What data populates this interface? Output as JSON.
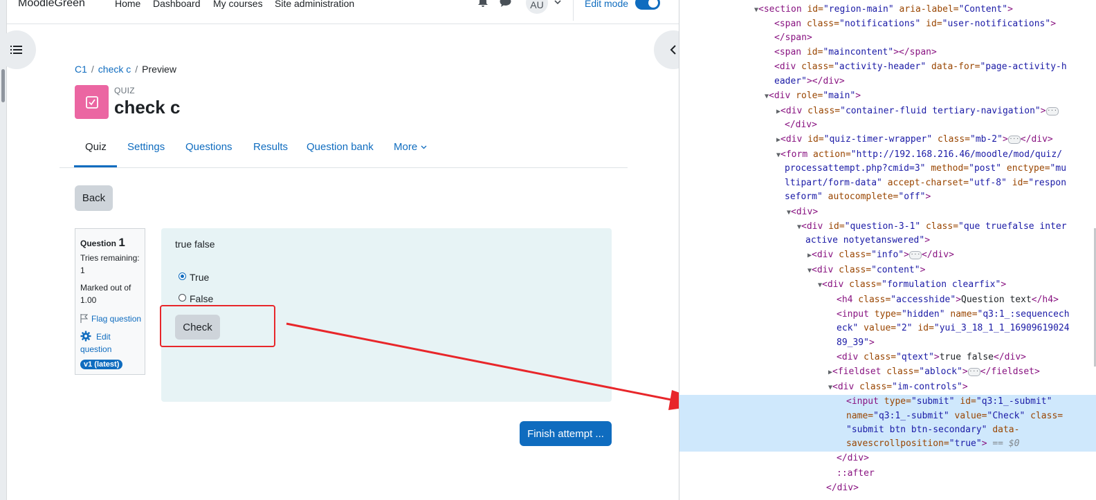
{
  "topnav": {
    "brand": "MoodleGreen",
    "links": [
      "Home",
      "Dashboard",
      "My courses",
      "Site administration"
    ],
    "avatar": "AU",
    "edit_mode": "Edit mode"
  },
  "breadcrumb": {
    "items": [
      "C1",
      "check c",
      "Preview"
    ]
  },
  "activity": {
    "type_label": "QUIZ",
    "title": "check c"
  },
  "tabs": [
    "Quiz",
    "Settings",
    "Questions",
    "Results",
    "Question bank",
    "More"
  ],
  "active_tab": "Quiz",
  "back_label": "Back",
  "question_info": {
    "question_word": "Question",
    "number": "1",
    "tries_label": "Tries remaining:",
    "tries_value": "1",
    "marked_label": "Marked out of",
    "marked_value": "1.00",
    "flag": "Flag question",
    "edit_line1": "Edit",
    "edit_line2": "question",
    "version": "v1 (latest)"
  },
  "question": {
    "text": "true false",
    "options": [
      "True",
      "False"
    ],
    "selected": "True",
    "check_label": "Check"
  },
  "finish_label": "Finish attempt ...",
  "devtools": {
    "l1": [
      "<section",
      " id=",
      "\"region-main\"",
      " aria-label=",
      "\"Content\"",
      ">"
    ],
    "l2": [
      "<span",
      " class=",
      "\"notifications\"",
      " id=",
      "\"user-notifications\"",
      ">"
    ],
    "l3": "</span>",
    "l4": [
      "<span",
      " id=",
      "\"maincontent\"",
      "></span>"
    ],
    "l5": [
      "<div",
      " class=",
      "\"activity-header\"",
      " data-for=",
      "\"page-activity-h"
    ],
    "l6": [
      "eader\"",
      "></div>"
    ],
    "l7": [
      "<div",
      " role=",
      "\"main\"",
      ">"
    ],
    "l8": [
      "<div",
      " class=",
      "\"container-fluid tertiary-navigation\"",
      ">"
    ],
    "l9": "</div>",
    "l10": [
      "<div",
      " id=",
      "\"quiz-timer-wrapper\"",
      " class=",
      "\"mb-2\"",
      ">",
      "</div>"
    ],
    "l11": [
      "<form",
      " action=",
      "\"http://192.168.216.46/moodle/mod/quiz/"
    ],
    "l12": [
      "processattempt.php?cmid=3\"",
      " method=",
      "\"post\"",
      " enctype=",
      "\"mu"
    ],
    "l13": [
      "ltipart/form-data\"",
      " accept-charset=",
      "\"utf-8\"",
      " id=",
      "\"respon"
    ],
    "l14": [
      "seform\"",
      " autocomplete=",
      "\"off\"",
      ">"
    ],
    "l15": "<div>",
    "l16": [
      "<div",
      " id=",
      "\"question-3-1\"",
      " class=",
      "\"que truefalse inter"
    ],
    "l17": [
      "active notyetanswered\"",
      ">"
    ],
    "l18": [
      "<div",
      " class=",
      "\"info\"",
      ">",
      "</div>"
    ],
    "l19": [
      "<div",
      " class=",
      "\"content\"",
      ">"
    ],
    "l20": [
      "<div",
      " class=",
      "\"formulation clearfix\"",
      ">"
    ],
    "l21": [
      "<h4",
      " class=",
      "\"accesshide\"",
      ">",
      "Question text",
      "</h4>"
    ],
    "l22": [
      "<input",
      " type=",
      "\"hidden\"",
      " name=",
      "\"q3:1_:sequencech"
    ],
    "l23": [
      "eck\"",
      " value=",
      "\"2\"",
      " id=",
      "\"yui_3_18_1_1_16909619024"
    ],
    "l24": [
      "89_39\"",
      ">"
    ],
    "l25": [
      "<div",
      " class=",
      "\"qtext\"",
      ">",
      "true false",
      "</div>"
    ],
    "l26": [
      "<fieldset",
      " class=",
      "\"ablock\"",
      ">",
      "</fieldset>"
    ],
    "l27": [
      "<div",
      " class=",
      "\"im-controls\"",
      ">"
    ],
    "l28": [
      "<input",
      " type=",
      "\"submit\"",
      " id=",
      "\"q3:1_-submit\""
    ],
    "l29": [
      "name=",
      "\"q3:1_-submit\"",
      " value=",
      "\"Check\"",
      " class="
    ],
    "l30": [
      "\"submit btn btn-secondary\"",
      " data-"
    ],
    "l31": [
      "savescrollposition=",
      "\"true\"",
      ">",
      " == $0"
    ],
    "l32": "</div>",
    "l33": "::after",
    "l34": "</div>"
  }
}
